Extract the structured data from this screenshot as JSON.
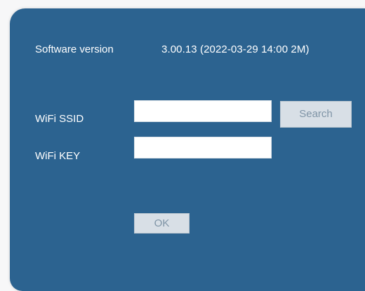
{
  "software_version": {
    "label": "Software version",
    "value": "3.00.13 (2022-03-29 14:00 2M)"
  },
  "wifi": {
    "ssid_label": "WiFi SSID",
    "ssid_value": "",
    "key_label": "WiFi KEY",
    "key_value": ""
  },
  "buttons": {
    "search_label": "Search",
    "ok_label": "OK"
  },
  "colors": {
    "panel_background": "#2c6390",
    "button_background": "#d8dfe6",
    "button_text": "#7f94a6"
  }
}
